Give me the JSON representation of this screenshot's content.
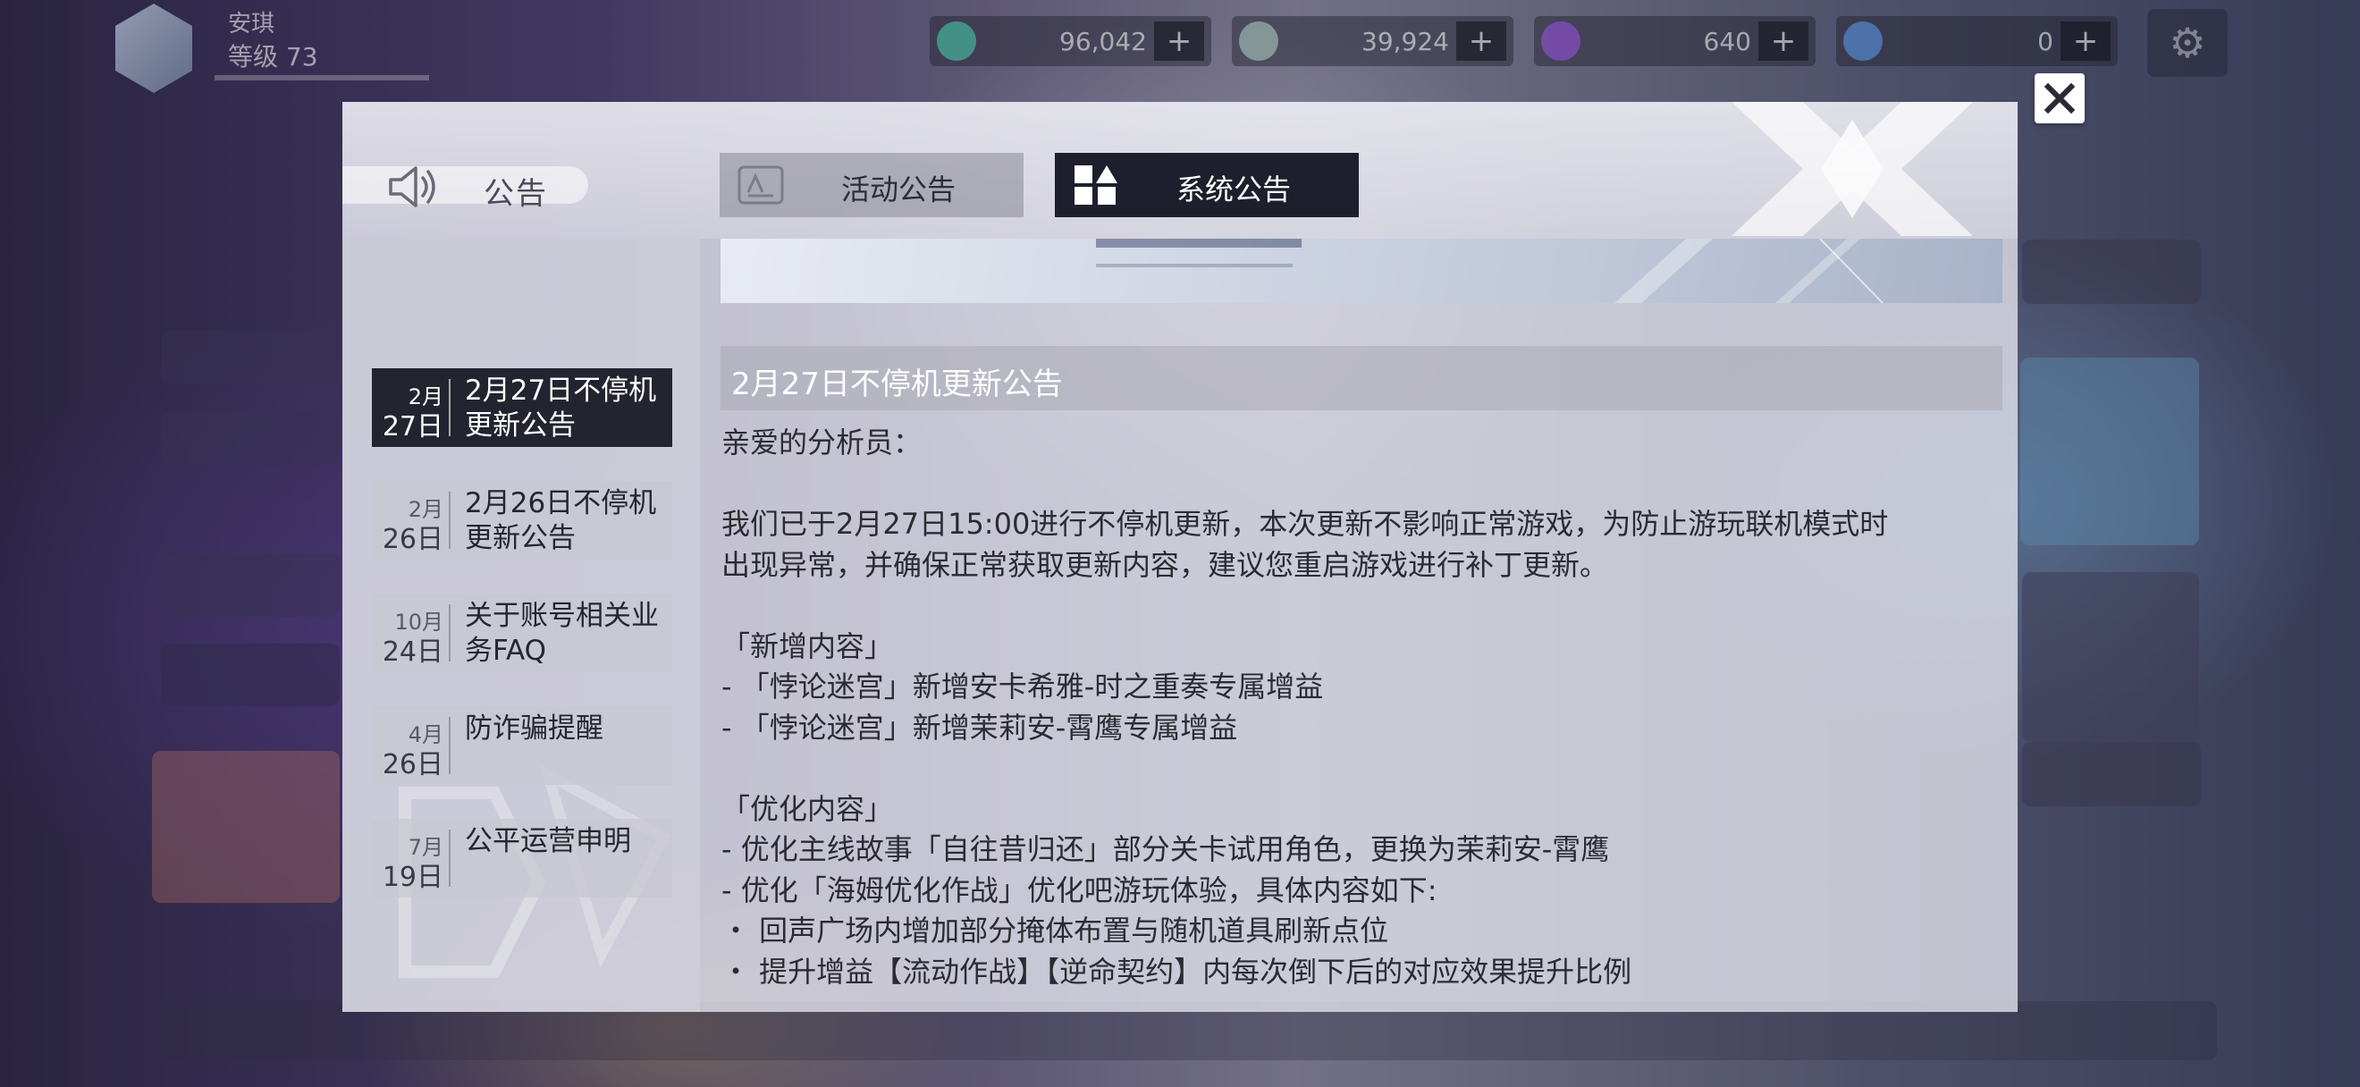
{
  "hud": {
    "player_name": "安琪",
    "level_label": "等级",
    "level_value": "73",
    "resources": [
      {
        "icon": "green-crystal-icon",
        "value": "96,042",
        "plus": "+"
      },
      {
        "icon": "coin-icon",
        "value": "39,924",
        "plus": "+"
      },
      {
        "icon": "purple-ticket-icon",
        "value": "640",
        "plus": "+"
      },
      {
        "icon": "blue-cube-icon",
        "value": "0",
        "plus": "+"
      }
    ],
    "settings_icon": "gear-icon"
  },
  "modal": {
    "header_title": "公告",
    "tabs": [
      {
        "label": "活动公告",
        "icon": "announcement-card-icon",
        "active": false
      },
      {
        "label": "系统公告",
        "icon": "system-grid-icon",
        "active": true
      }
    ],
    "close_icon": "close-icon",
    "sidebar": [
      {
        "month": "2月",
        "day": "27日",
        "title": "2月27日不停机更新公告",
        "active": true
      },
      {
        "month": "2月",
        "day": "26日",
        "title": "2月26日不停机更新公告",
        "active": false
      },
      {
        "month": "10月",
        "day": "24日",
        "title": "关于账号相关业务FAQ",
        "active": false
      },
      {
        "month": "4月",
        "day": "26日",
        "title": "防诈骗提醒",
        "active": false
      },
      {
        "month": "7月",
        "day": "19日",
        "title": "公平运营申明",
        "active": false
      }
    ],
    "article": {
      "heading": "2月27日不停机更新公告",
      "lines": [
        "亲爱的分析员：",
        "",
        "我们已于2月27日15:00进行不停机更新，本次更新不影响正常游戏，为防止游玩联机模式时",
        "出现异常，并确保正常获取更新内容，建议您重启游戏进行补丁更新。",
        "",
        "「新增内容」",
        "- 「悖论迷宫」新增安卡希雅-时之重奏专属增益",
        "- 「悖论迷宫」新增茉莉安-霄鹰专属增益",
        "",
        "「优化内容」",
        "- 优化主线故事「自往昔归还」部分关卡试用角色，更换为茉莉安-霄鹰",
        "- 优化「海姆优化作战」优化吧游玩体验，具体内容如下:",
        "・ 回声广场内增加部分掩体布置与随机道具刷新点位",
        "・ 提升增益【流动作战】【逆命契约】内每次倒下后的对应效果提升比例"
      ]
    }
  },
  "colors": {
    "active_tab_bg": "#1e1f2c",
    "modal_bg": "#e2e2ec",
    "heading_bar": "#aaaab4"
  }
}
